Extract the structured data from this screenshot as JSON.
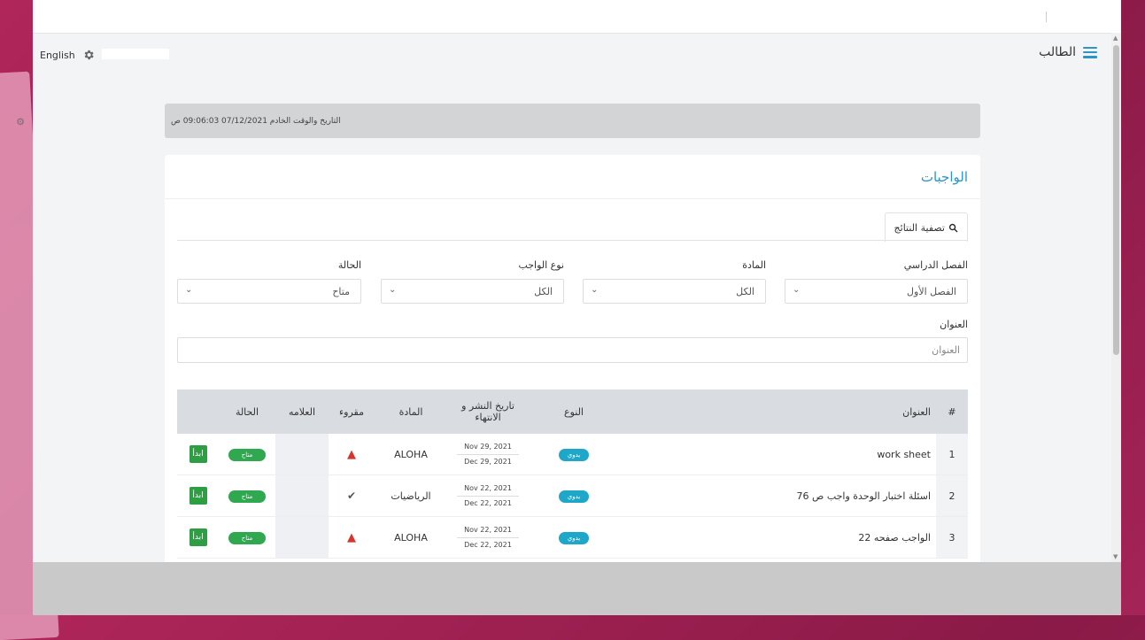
{
  "navbar": {
    "language_label": "English",
    "role_label": "الطالب"
  },
  "datetime_text": "التاريخ والوقت الخادم 07/12/2021 09:06:03 ص",
  "panel": {
    "title": "الواجبات",
    "filter_button": "تصفية النتائج"
  },
  "filters": {
    "semester": {
      "label": "الفصل الدراسي",
      "value": "الفصل الأول"
    },
    "subject": {
      "label": "المادة",
      "value": "الكل"
    },
    "assignment_type": {
      "label": "نوع الواجب",
      "value": "الكل"
    },
    "status": {
      "label": "الحالة",
      "value": "متاح"
    },
    "title": {
      "label": "العنوان",
      "placeholder": "العنوان"
    }
  },
  "table": {
    "headers": {
      "num": "#",
      "title": "العنوان",
      "type": "النوع",
      "dates": "تاريخ النشر و الانتهاء",
      "subject": "المادة",
      "read": "مقروء",
      "mark": "العلامه",
      "status": "الحالة"
    },
    "rows": [
      {
        "num": "1",
        "title": "work sheet",
        "type": "يدوي",
        "publish": "Nov 29, 2021",
        "end": "Dec 29, 2021",
        "subject": "ALOHA",
        "read": "warning",
        "status": "متاح",
        "action": "ابدأ"
      },
      {
        "num": "2",
        "title": "اسئلة اختبار الوحدة واجب ص 76",
        "type": "يدوي",
        "publish": "Nov 22, 2021",
        "end": "Dec 22, 2021",
        "subject": "الرياضيات",
        "read": "check",
        "status": "متاح",
        "action": "ابدأ"
      },
      {
        "num": "3",
        "title": "الواجب صفحه 22",
        "type": "يدوي",
        "publish": "Nov 22, 2021",
        "end": "Dec 22, 2021",
        "subject": "ALOHA",
        "read": "warning",
        "status": "متاح",
        "action": "ابدأ"
      }
    ]
  },
  "colors": {
    "accent": "#2b94c9",
    "success": "#2fa84f",
    "info": "#1ea7c9",
    "danger": "#d9332e",
    "background": "#a42457"
  }
}
